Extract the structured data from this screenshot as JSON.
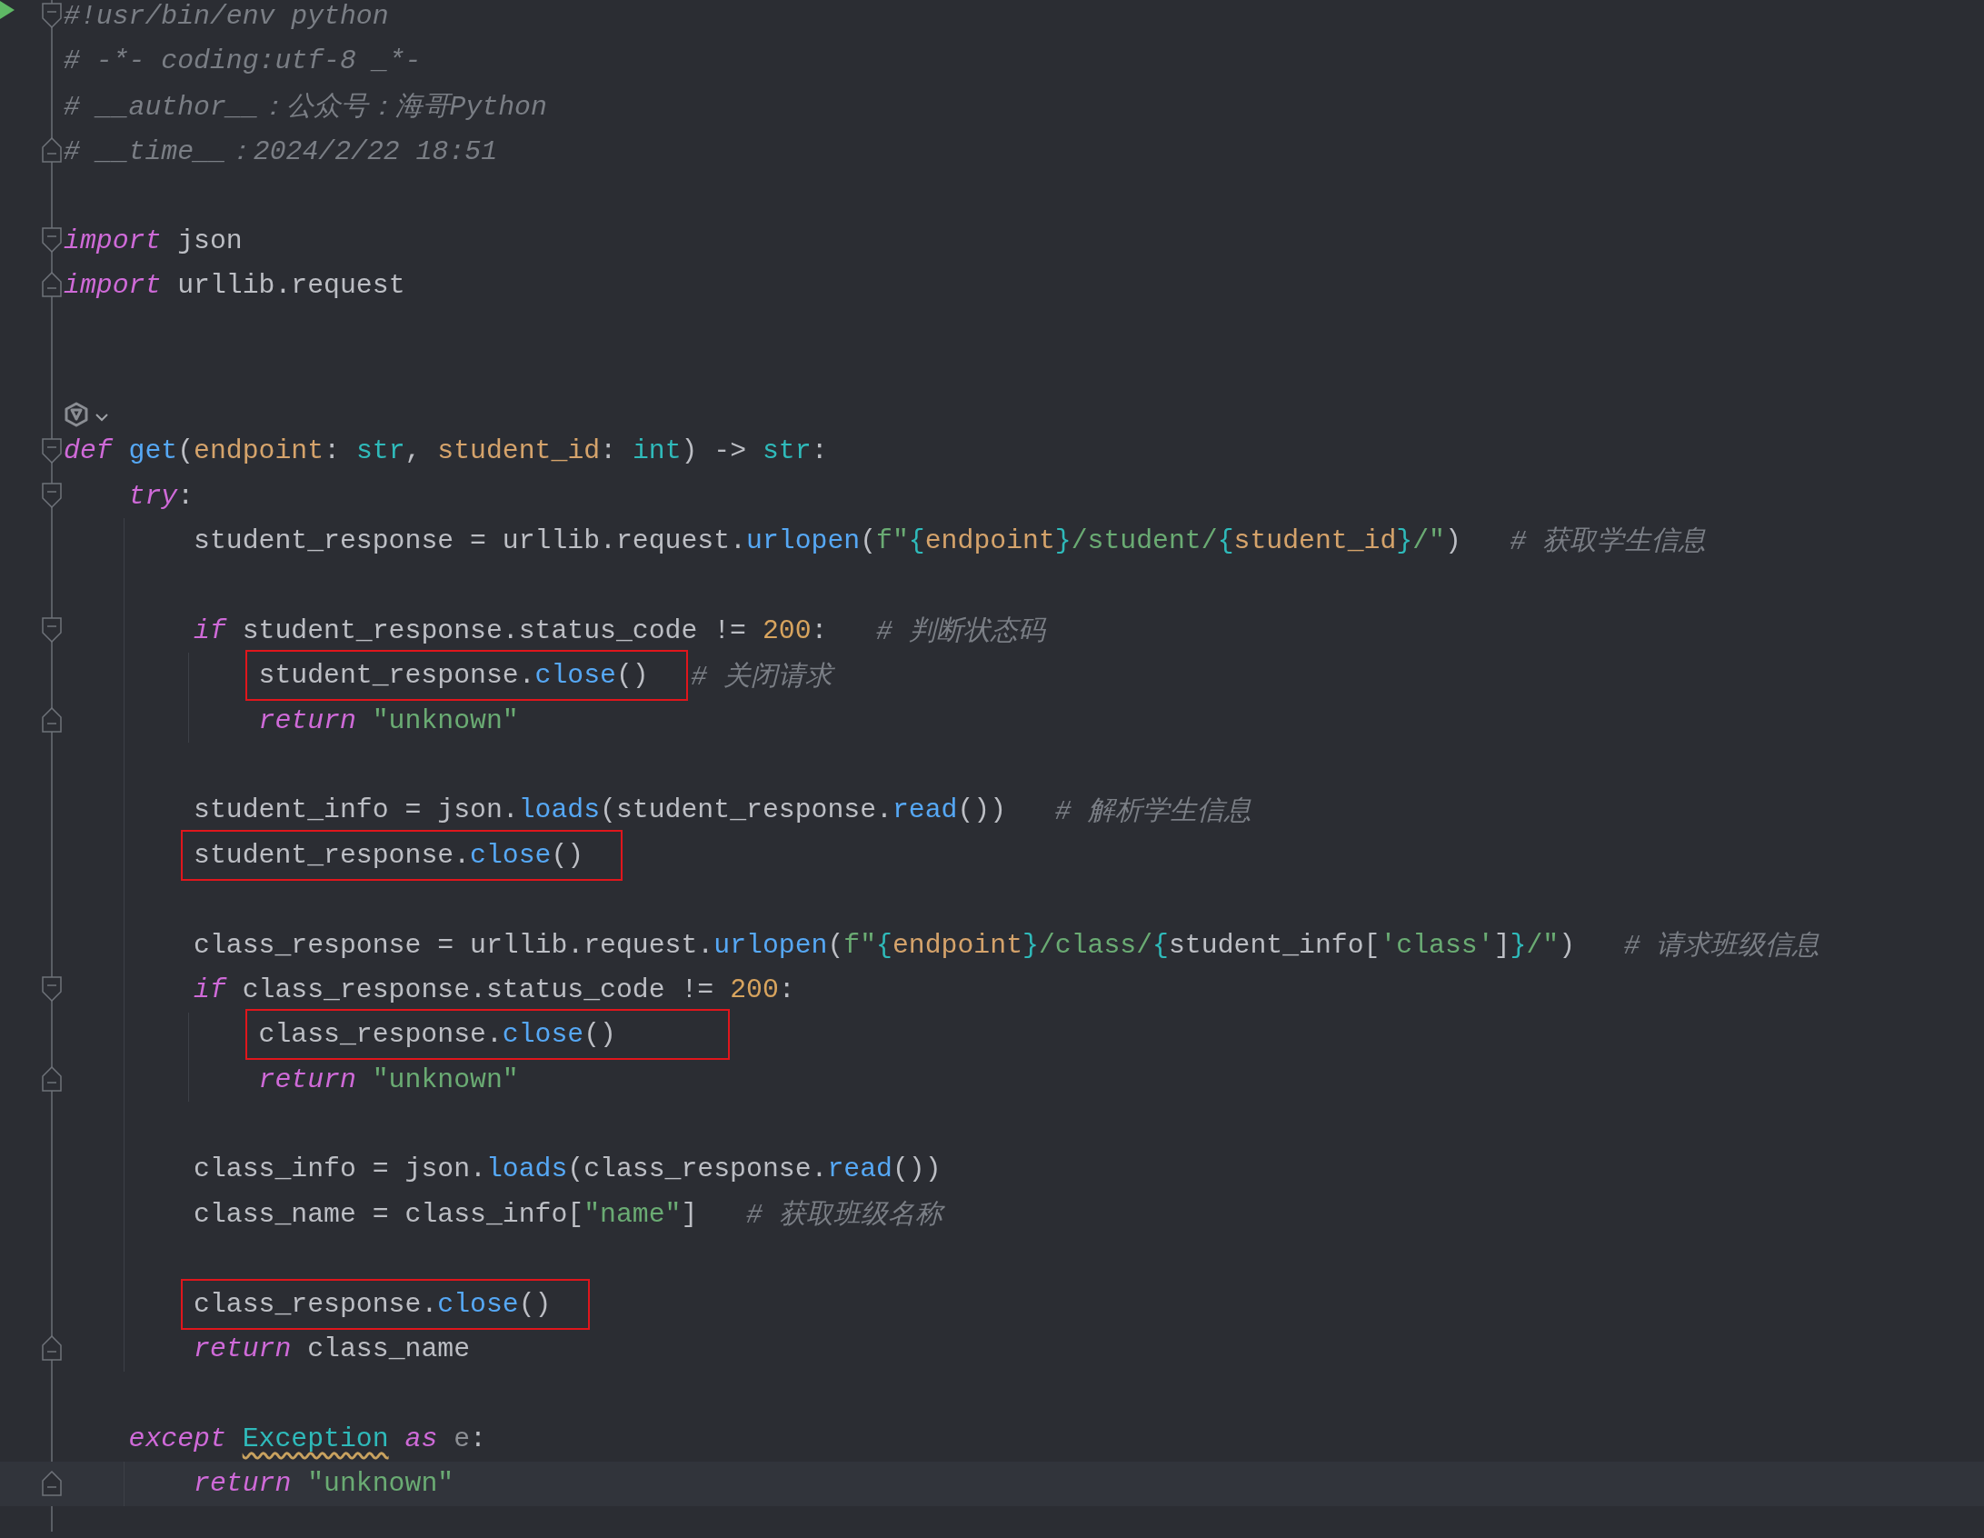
{
  "editor": {
    "lines": [
      {
        "kind": "code",
        "run": true,
        "fold_start": true,
        "tokens": [
          {
            "kind": "comment",
            "text": "#!usr/bin/env python"
          }
        ]
      },
      {
        "kind": "code",
        "tokens": [
          {
            "kind": "comment",
            "text": "# -*- coding:utf-8 _*-"
          }
        ]
      },
      {
        "kind": "code",
        "tokens": [
          {
            "kind": "comment",
            "text": "# __author__：公众号：海哥Python"
          }
        ]
      },
      {
        "kind": "code",
        "fold_end": true,
        "tokens": [
          {
            "kind": "comment",
            "text": "# __time__：2024/2/22 18:51"
          }
        ]
      },
      {
        "kind": "blank"
      },
      {
        "kind": "code",
        "fold_start": true,
        "tokens": [
          {
            "kind": "keyword",
            "text": "import"
          },
          {
            "kind": "plain",
            "text": " json"
          }
        ]
      },
      {
        "kind": "code",
        "fold_end": true,
        "tokens": [
          {
            "kind": "keyword",
            "text": "import"
          },
          {
            "kind": "plain",
            "text": " urllib.request"
          }
        ]
      },
      {
        "kind": "blank"
      },
      {
        "kind": "blank"
      },
      {
        "kind": "inlay"
      },
      {
        "kind": "code",
        "fold_start": true,
        "tokens": [
          {
            "kind": "keyword",
            "text": "def "
          },
          {
            "kind": "function",
            "text": "get"
          },
          {
            "kind": "plain",
            "text": "("
          },
          {
            "kind": "param",
            "text": "endpoint"
          },
          {
            "kind": "plain",
            "text": ": "
          },
          {
            "kind": "builtin",
            "text": "str"
          },
          {
            "kind": "plain",
            "text": ", "
          },
          {
            "kind": "param",
            "text": "student_id"
          },
          {
            "kind": "plain",
            "text": ": "
          },
          {
            "kind": "builtin",
            "text": "int"
          },
          {
            "kind": "plain",
            "text": ") -> "
          },
          {
            "kind": "builtin",
            "text": "str"
          },
          {
            "kind": "plain",
            "text": ":"
          }
        ],
        "children": [
          {
            "kind": "code",
            "fold_start": true,
            "tokens": [
              {
                "kind": "keyword",
                "text": "try"
              },
              {
                "kind": "plain",
                "text": ":"
              }
            ],
            "children": [
              {
                "kind": "code",
                "tokens": [
                  {
                    "kind": "plain",
                    "text": "student_response = urllib.request."
                  },
                  {
                    "kind": "method",
                    "text": "urlopen"
                  },
                  {
                    "kind": "plain",
                    "text": "("
                  },
                  {
                    "kind": "string",
                    "text": "f\""
                  },
                  {
                    "kind": "brace",
                    "text": "{"
                  },
                  {
                    "kind": "interp",
                    "text": "endpoint"
                  },
                  {
                    "kind": "brace",
                    "text": "}"
                  },
                  {
                    "kind": "string",
                    "text": "/student/"
                  },
                  {
                    "kind": "brace",
                    "text": "{"
                  },
                  {
                    "kind": "interp",
                    "text": "student_id"
                  },
                  {
                    "kind": "brace",
                    "text": "}"
                  },
                  {
                    "kind": "string",
                    "text": "/\""
                  },
                  {
                    "kind": "plain",
                    "text": ")"
                  },
                  {
                    "kind": "comment",
                    "text": "# 获取学生信息"
                  }
                ]
              },
              {
                "kind": "blank"
              },
              {
                "kind": "code",
                "fold_start": true,
                "tokens": [
                  {
                    "kind": "keyword",
                    "text": "if"
                  },
                  {
                    "kind": "plain",
                    "text": " student_response.status_code != "
                  },
                  {
                    "kind": "number",
                    "text": "200"
                  },
                  {
                    "kind": "plain",
                    "text": ":"
                  },
                  {
                    "kind": "comment",
                    "text": "# 判断状态码"
                  }
                ],
                "children": [
                  {
                    "kind": "code",
                    "boxed": true,
                    "tokens": [
                      {
                        "kind": "plain",
                        "text": "student_response."
                      },
                      {
                        "kind": "method",
                        "text": "close"
                      },
                      {
                        "kind": "plain",
                        "text": "()"
                      },
                      {
                        "kind": "comment",
                        "text": "# 关闭请求"
                      }
                    ]
                  },
                  {
                    "kind": "code",
                    "fold_end": true,
                    "tokens": [
                      {
                        "kind": "keyword",
                        "text": "return "
                      },
                      {
                        "kind": "string",
                        "text": "\"unknown\""
                      }
                    ]
                  }
                ]
              },
              {
                "kind": "blank"
              },
              {
                "kind": "code",
                "tokens": [
                  {
                    "kind": "plain",
                    "text": "student_info = json."
                  },
                  {
                    "kind": "method",
                    "text": "loads"
                  },
                  {
                    "kind": "plain",
                    "text": "(student_response."
                  },
                  {
                    "kind": "method",
                    "text": "read"
                  },
                  {
                    "kind": "plain",
                    "text": "())"
                  },
                  {
                    "kind": "comment",
                    "text": "# 解析学生信息"
                  }
                ]
              },
              {
                "kind": "code",
                "boxed": true,
                "tokens": [
                  {
                    "kind": "plain",
                    "text": "student_response."
                  },
                  {
                    "kind": "method",
                    "text": "close"
                  },
                  {
                    "kind": "plain",
                    "text": "()"
                  }
                ]
              },
              {
                "kind": "blank"
              },
              {
                "kind": "code",
                "tokens": [
                  {
                    "kind": "plain",
                    "text": "class_response = urllib.request."
                  },
                  {
                    "kind": "method",
                    "text": "urlopen"
                  },
                  {
                    "kind": "plain",
                    "text": "("
                  },
                  {
                    "kind": "string",
                    "text": "f\""
                  },
                  {
                    "kind": "brace",
                    "text": "{"
                  },
                  {
                    "kind": "interp",
                    "text": "endpoint"
                  },
                  {
                    "kind": "brace",
                    "text": "}"
                  },
                  {
                    "kind": "string",
                    "text": "/class/"
                  },
                  {
                    "kind": "brace",
                    "text": "{"
                  },
                  {
                    "kind": "plain",
                    "text": "student_info["
                  },
                  {
                    "kind": "string",
                    "text": "'class'"
                  },
                  {
                    "kind": "plain",
                    "text": "]"
                  },
                  {
                    "kind": "brace",
                    "text": "}"
                  },
                  {
                    "kind": "string",
                    "text": "/\""
                  },
                  {
                    "kind": "plain",
                    "text": ")"
                  },
                  {
                    "kind": "comment",
                    "text": "# 请求班级信息"
                  }
                ]
              },
              {
                "kind": "code",
                "fold_start": true,
                "tokens": [
                  {
                    "kind": "keyword",
                    "text": "if"
                  },
                  {
                    "kind": "plain",
                    "text": " class_response.status_code != "
                  },
                  {
                    "kind": "number",
                    "text": "200"
                  },
                  {
                    "kind": "plain",
                    "text": ":"
                  }
                ],
                "children": [
                  {
                    "kind": "code",
                    "boxed": true,
                    "wide": true,
                    "tokens": [
                      {
                        "kind": "plain",
                        "text": "class_response."
                      },
                      {
                        "kind": "method",
                        "text": "close"
                      },
                      {
                        "kind": "plain",
                        "text": "()"
                      }
                    ]
                  },
                  {
                    "kind": "code",
                    "fold_end": true,
                    "tokens": [
                      {
                        "kind": "keyword",
                        "text": "return "
                      },
                      {
                        "kind": "string",
                        "text": "\"unknown\""
                      }
                    ]
                  }
                ]
              },
              {
                "kind": "blank"
              },
              {
                "kind": "code",
                "tokens": [
                  {
                    "kind": "plain",
                    "text": "class_info = json."
                  },
                  {
                    "kind": "method",
                    "text": "loads"
                  },
                  {
                    "kind": "plain",
                    "text": "(class_response."
                  },
                  {
                    "kind": "method",
                    "text": "read"
                  },
                  {
                    "kind": "plain",
                    "text": "())"
                  }
                ]
              },
              {
                "kind": "code",
                "tokens": [
                  {
                    "kind": "plain",
                    "text": "class_name = class_info["
                  },
                  {
                    "kind": "string",
                    "text": "\"name\""
                  },
                  {
                    "kind": "plain",
                    "text": "]"
                  },
                  {
                    "kind": "comment",
                    "text": "# 获取班级名称"
                  }
                ]
              },
              {
                "kind": "blank"
              },
              {
                "kind": "code",
                "boxed": true,
                "tokens": [
                  {
                    "kind": "plain",
                    "text": "class_response."
                  },
                  {
                    "kind": "method",
                    "text": "close"
                  },
                  {
                    "kind": "plain",
                    "text": "()"
                  }
                ]
              },
              {
                "kind": "code",
                "fold_end": true,
                "tokens": [
                  {
                    "kind": "keyword",
                    "text": "return"
                  },
                  {
                    "kind": "plain",
                    "text": " class_name"
                  }
                ]
              }
            ]
          },
          {
            "kind": "blank"
          },
          {
            "kind": "code",
            "tokens": [
              {
                "kind": "keyword",
                "text": "except "
              },
              {
                "kind": "warn",
                "text": "Exception"
              },
              {
                "kind": "keyword",
                "text": " as "
              },
              {
                "kind": "unused",
                "text": "e"
              },
              {
                "kind": "plain",
                "text": ":"
              }
            ],
            "children": [
              {
                "kind": "code",
                "fold_end": true,
                "current": true,
                "tokens": [
                  {
                    "kind": "keyword",
                    "text": "return "
                  },
                  {
                    "kind": "string",
                    "text": "\"unknown\""
                  }
                ]
              }
            ]
          }
        ]
      }
    ]
  }
}
